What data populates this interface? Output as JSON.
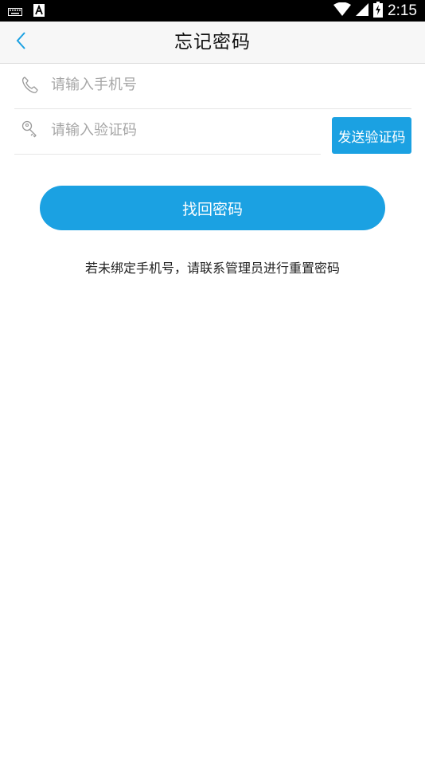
{
  "status_bar": {
    "time": "2:15",
    "icons": [
      "keyboard-icon",
      "font-a-icon",
      "wifi-icon",
      "signal-icon",
      "battery-charging-icon"
    ]
  },
  "header": {
    "title": "忘记密码",
    "back_icon": "chevron-left-icon"
  },
  "form": {
    "phone": {
      "placeholder": "请输入手机号",
      "value": "",
      "icon": "phone-icon"
    },
    "code": {
      "placeholder": "请输入验证码",
      "value": "",
      "icon": "key-icon"
    },
    "send_code_label": "发送验证码",
    "submit_label": "找回密码"
  },
  "hint": "若未绑定手机号，请联系管理员进行重置密码",
  "colors": {
    "accent": "#1ba1e2",
    "status_bar": "#000000",
    "app_bar": "#f7f7f7",
    "placeholder": "#a6a6a6"
  }
}
